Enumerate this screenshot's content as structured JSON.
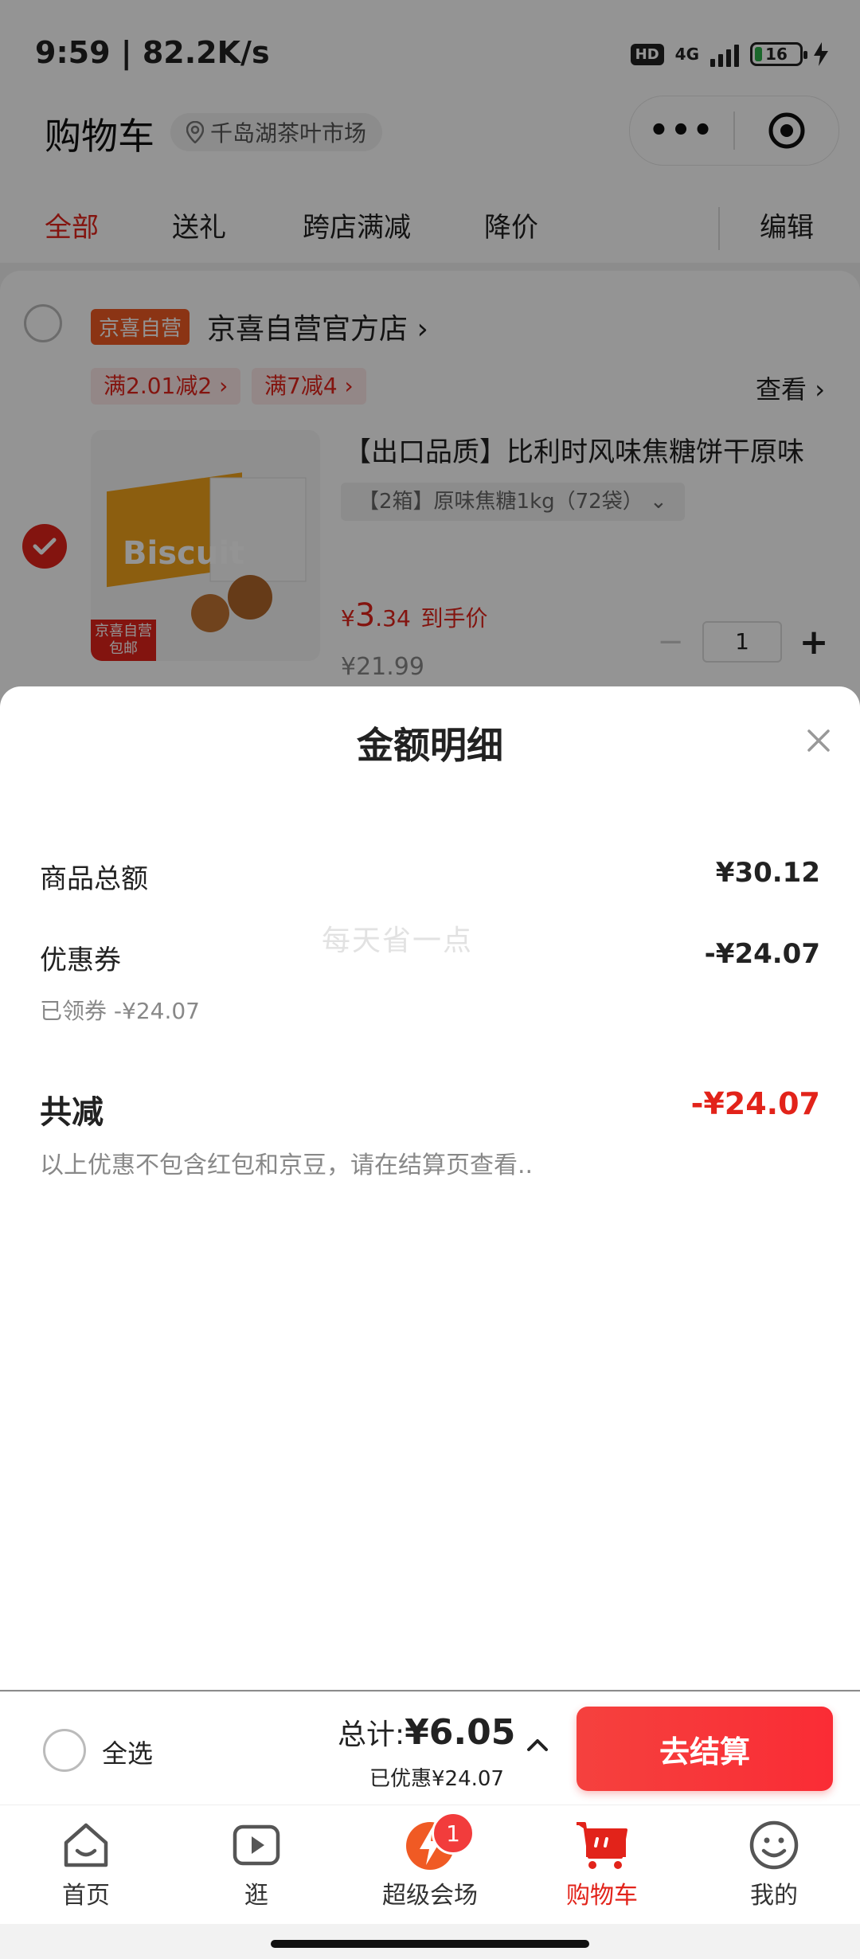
{
  "status_bar": {
    "time": "9:59 | 82.2K/s",
    "hd": "HD",
    "network": "4G",
    "battery": "16"
  },
  "header": {
    "title": "购物车",
    "location": "千岛湖茶叶市场"
  },
  "tabs": [
    "全部",
    "送礼",
    "跨店满减",
    "降价"
  ],
  "edit_label": "编辑",
  "store": {
    "badge": "京喜自营",
    "name": "京喜自营官方店",
    "promos": [
      "满2.01减2",
      "满7减4"
    ],
    "view_label": "查看"
  },
  "product": {
    "title": "【出口品质】比利时风味焦糖饼干原味",
    "spec": "【2箱】原味焦糖1kg（72袋）",
    "price_symbol": "¥",
    "price_int": "3",
    "price_dec": ".34",
    "price_note": "到手价",
    "original_price": "¥21.99",
    "quantity": "1",
    "image_badge_line1": "京喜自营",
    "image_badge_line2": "包邮",
    "image_brand": "Biscuit"
  },
  "sheet": {
    "title": "金额明细",
    "rows": [
      {
        "label": "商品总额",
        "value": "¥30.12"
      },
      {
        "label": "优惠券",
        "value": "-¥24.07",
        "sub": "已领券 -¥24.07"
      }
    ],
    "watermark": "每天省一点",
    "total_label": "共减",
    "total_value": "-¥24.07",
    "note": "以上优惠不包含红包和京豆，请在结算页查看.."
  },
  "checkout": {
    "select_all": "全选",
    "sum_label": "总计:",
    "sum_value": "¥6.05",
    "saved": "已优惠¥24.07",
    "button": "去结算"
  },
  "nav": {
    "items": [
      {
        "label": "首页",
        "icon": "home-icon"
      },
      {
        "label": "逛",
        "icon": "video-icon"
      },
      {
        "label": "超级会场",
        "icon": "super-venue-icon",
        "badge": "1"
      },
      {
        "label": "购物车",
        "icon": "cart-icon",
        "active": true
      },
      {
        "label": "我的",
        "icon": "profile-icon"
      }
    ]
  },
  "colors": {
    "accent": "#e2231a",
    "checkout_button": "#f5413e",
    "store_badge": "#f05a24"
  }
}
